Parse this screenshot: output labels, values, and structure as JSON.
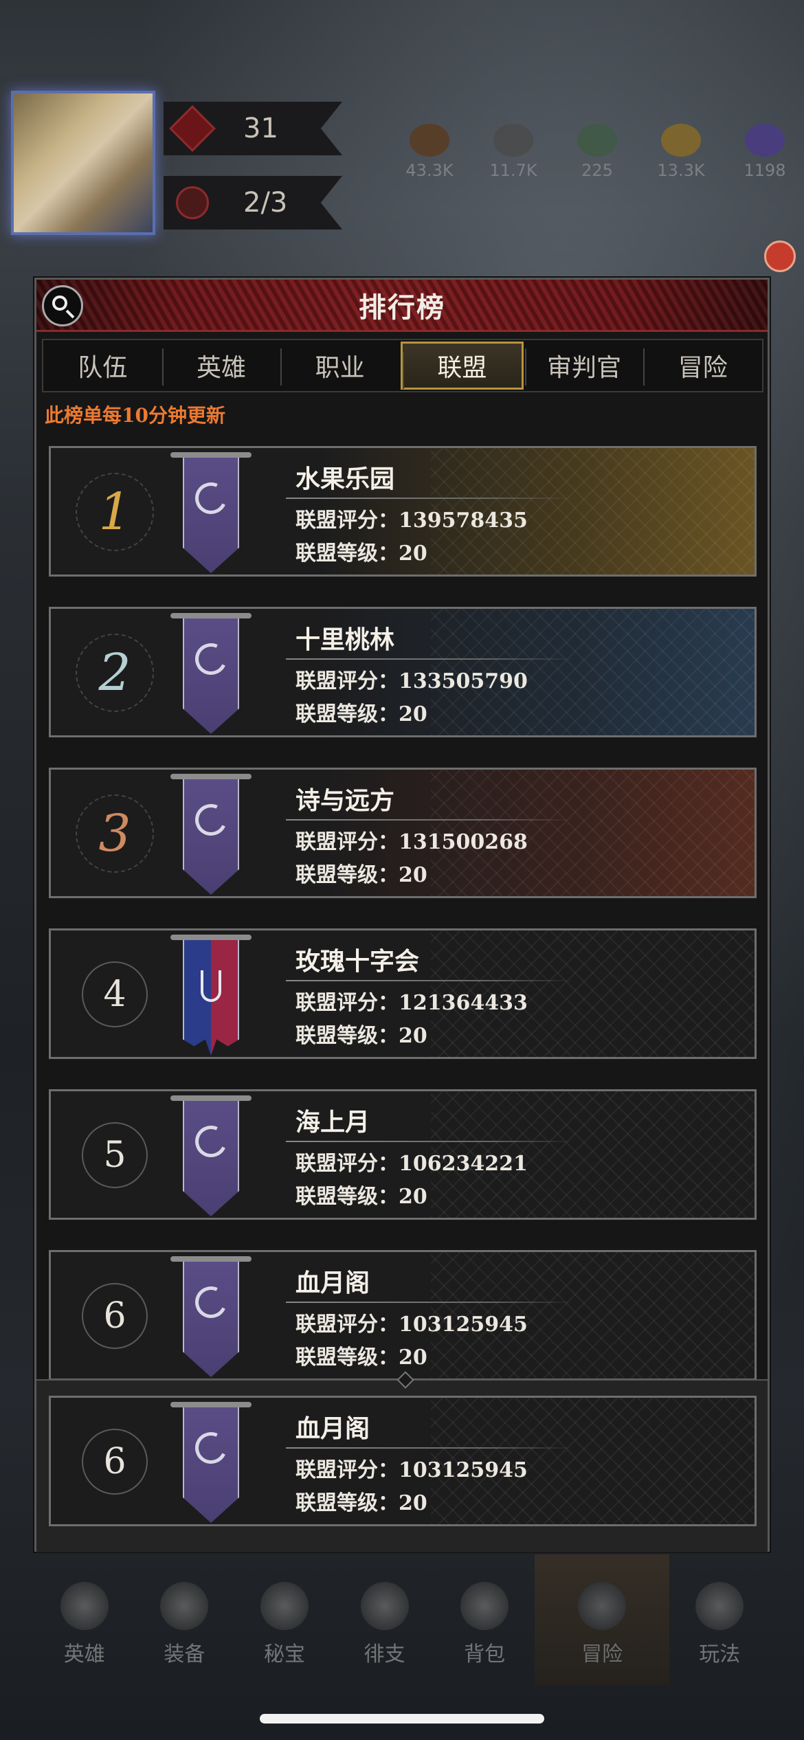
{
  "hud": {
    "level": "31",
    "stamina": "2/3",
    "resources": [
      {
        "icon": "chest-icon",
        "amount": "43.3K"
      },
      {
        "icon": "ore-icon",
        "amount": "11.7K"
      },
      {
        "icon": "crystal-icon",
        "amount": "225"
      },
      {
        "icon": "gold-icon",
        "amount": "13.3K"
      },
      {
        "icon": "gem-icon",
        "amount": "1198"
      }
    ]
  },
  "panel": {
    "title": "排行榜",
    "notice": "此榜单每10分钟更新",
    "tabs": [
      {
        "label": "队伍",
        "active": false
      },
      {
        "label": "英雄",
        "active": false
      },
      {
        "label": "职业",
        "active": false
      },
      {
        "label": "联盟",
        "active": true
      },
      {
        "label": "审判官",
        "active": false
      },
      {
        "label": "冒险",
        "active": false
      }
    ]
  },
  "rankings": [
    {
      "rank": "1",
      "name": "水果乐园",
      "score_label": "联盟评分：",
      "score": "139578435",
      "level_label": "联盟等级：",
      "level": "20",
      "banner": "moon-banner-icon",
      "color": "#c9a04a"
    },
    {
      "rank": "2",
      "name": "十里桃林",
      "score_label": "联盟评分：",
      "score": "133505790",
      "level_label": "联盟等级：",
      "level": "20",
      "banner": "moon-banner-icon",
      "color": "#a9c2c6"
    },
    {
      "rank": "3",
      "name": "诗与远方",
      "score_label": "联盟评分：",
      "score": "131500268",
      "level_label": "联盟等级：",
      "level": "20",
      "banner": "moon-banner-icon",
      "color": "#c97a52"
    },
    {
      "rank": "4",
      "name": "玫瑰十字会",
      "score_label": "联盟评分：",
      "score": "121364433",
      "level_label": "联盟等级：",
      "level": "20",
      "banner": "rose-chalice-banner-icon",
      "color": "#e8e4dc"
    },
    {
      "rank": "5",
      "name": "海上月",
      "score_label": "联盟评分：",
      "score": "106234221",
      "level_label": "联盟等级：",
      "level": "20",
      "banner": "moon-banner-icon",
      "color": "#e8e4dc"
    },
    {
      "rank": "6",
      "name": "血月阁",
      "score_label": "联盟评分：",
      "score": "103125945",
      "level_label": "联盟等级：",
      "level": "20",
      "banner": "moon-banner-icon",
      "color": "#e8e4dc"
    }
  ],
  "my_alliance": {
    "rank": "6",
    "name": "血月阁",
    "score_label": "联盟评分：",
    "score": "103125945",
    "level_label": "联盟等级：",
    "level": "20",
    "banner": "moon-banner-icon"
  },
  "bottom_nav": [
    {
      "label": "英雄",
      "icon": "hero-icon"
    },
    {
      "label": "装备",
      "icon": "equipment-icon"
    },
    {
      "label": "秘宝",
      "icon": "treasure-icon"
    },
    {
      "label": "徘支",
      "icon": "branch-icon"
    },
    {
      "label": "背包",
      "icon": "bag-icon"
    },
    {
      "label": "冒险",
      "icon": "crossed-swords-icon"
    },
    {
      "label": "玩法",
      "icon": "gameplay-icon"
    }
  ]
}
